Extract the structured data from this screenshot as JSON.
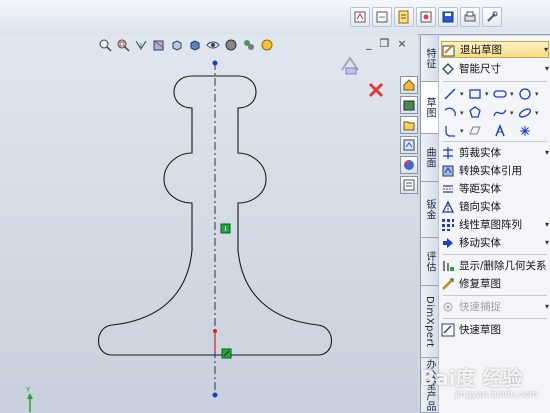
{
  "window_controls": {
    "minimize": "_",
    "restore": "❐",
    "close": "×"
  },
  "command_tabs": [
    "特征",
    "草图",
    "曲面",
    "钣金",
    "评估",
    "DimXpert",
    "办公室产品"
  ],
  "commands": {
    "exit_sketch": "退出草图",
    "smart_dimension": "智能尺寸",
    "trim_entities": "剪裁实体",
    "convert_entities": "转换实体引用",
    "offset_entities": "等距实体",
    "mirror_entities": "镜向实体",
    "linear_pattern": "线性草图阵列",
    "move_entities": "移动实体",
    "display_delete_relations": "显示/删除几何关系",
    "repair_sketch": "修复草图",
    "quick_snaps": "快速捕捉",
    "rapid_sketch": "快速草图"
  },
  "watermark": {
    "brand": "Bai度 经验",
    "url": "jingyan.baidu.com"
  },
  "colors": {
    "accent_blue": "#1a3fd0",
    "sketch_line": "#1a1a1a",
    "centerline": "#333333",
    "relation_green": "#1fa83a",
    "point_red": "#e02020",
    "tab_border": "#8c99ad",
    "highlight": "#f7dd87"
  }
}
